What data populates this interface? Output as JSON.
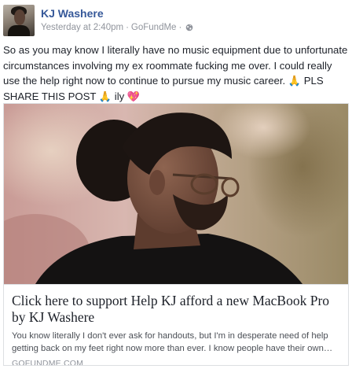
{
  "post": {
    "author": "KJ Washere",
    "timestamp": "Yesterday at 2:40pm",
    "separator": "·",
    "app": "GoFundMe",
    "privacy_icon": "globe-icon",
    "text_main": "So as you may know I literally have no music equipment due to unfortunate circumstances involving my ex roommate fucking me over. I could really use the help right now to continue to pursue my music career.",
    "emoji_pray_1": "🙏",
    "text_share": " PLS SHARE THIS POST ",
    "emoji_pray_2": "🙏",
    "text_ily": " ily ",
    "emoji_heart": "💖"
  },
  "link_card": {
    "title": "Click here to support Help KJ afford a new MacBook Pro by KJ Washere",
    "description": "You know literally I don't ever ask for handouts, but I'm in desperate need of help getting back on my feet right now more than ever. I know people have their own…",
    "domain": "GOFUNDME.COM"
  },
  "colors": {
    "author_link": "#365899",
    "meta_text": "#90949c",
    "body_text": "#1d2129",
    "border": "#dddfe2"
  }
}
